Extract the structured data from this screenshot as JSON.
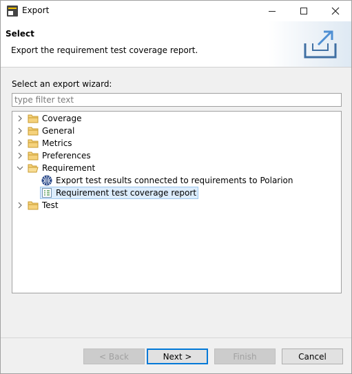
{
  "window": {
    "title": "Export"
  },
  "header": {
    "title": "Select",
    "description": "Export the requirement test coverage report."
  },
  "body": {
    "select_label": "Select an export wizard:",
    "filter_placeholder": "type filter text"
  },
  "tree": {
    "items": [
      {
        "label": "Coverage",
        "icon": "folder-icon",
        "expanded": false
      },
      {
        "label": "General",
        "icon": "folder-icon",
        "expanded": false
      },
      {
        "label": "Metrics",
        "icon": "folder-icon",
        "expanded": false
      },
      {
        "label": "Preferences",
        "icon": "folder-icon",
        "expanded": false
      },
      {
        "label": "Requirement",
        "icon": "folder-icon",
        "expanded": true,
        "children": [
          {
            "label": "Export test results connected to requirements to Polarion",
            "icon": "polarion-icon"
          },
          {
            "label": "Requirement test coverage report",
            "icon": "report-icon",
            "selected": true
          }
        ]
      },
      {
        "label": "Test",
        "icon": "folder-icon",
        "expanded": false
      }
    ]
  },
  "buttons": {
    "back": "< Back",
    "next": "Next >",
    "finish": "Finish",
    "cancel": "Cancel"
  },
  "colors": {
    "selection_bg": "#dcecfc",
    "selection_border": "#7eb4ea",
    "default_button_border": "#0078d7",
    "folder": "#e8b84a"
  }
}
